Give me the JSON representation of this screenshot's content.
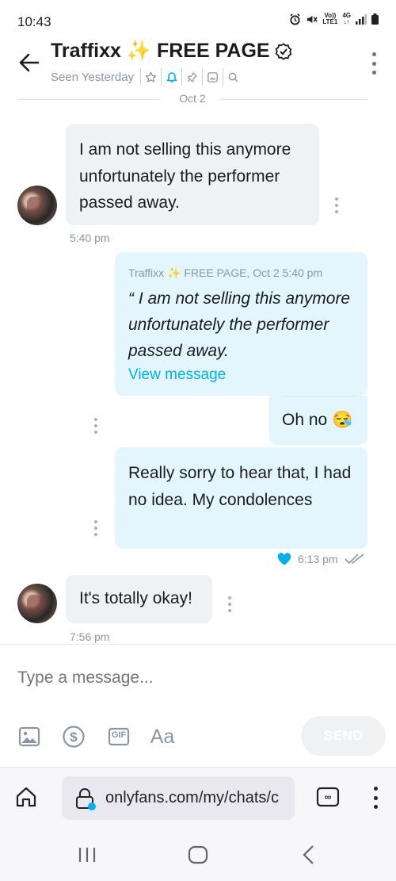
{
  "status_bar": {
    "time": "10:43",
    "network_top": "4G",
    "network_bottom": "LTE1",
    "volte": "Vo))"
  },
  "header": {
    "title": "Traffixx ✨ FREE PAGE",
    "seen": "Seen Yesterday",
    "icons": [
      "star-icon",
      "bell-icon",
      "pin-icon",
      "gallery-icon",
      "search-icon"
    ]
  },
  "messages": {
    "date_divider": "Oct 2",
    "m1": {
      "text": "I am not selling this anymore unfortunately the performer passed away.",
      "time": "5:40 pm"
    },
    "m2": {
      "quote_meta": "Traffixx ✨ FREE PAGE, Oct 2 5:40 pm",
      "quote_text": "“ I am not selling this anymore unfortunately the performer passed away.",
      "view_link": "View message"
    },
    "m3": {
      "text": "Oh no 😪"
    },
    "m4": {
      "text": "Really sorry to hear that, I had no idea. My condolences",
      "time": "6:13 pm"
    },
    "m5": {
      "text": "It's totally okay!",
      "time": "7:56 pm"
    }
  },
  "composer": {
    "placeholder": "Type a message...",
    "send_label": "SEND",
    "font_label": "Aa",
    "gif_label": "GIF"
  },
  "browser": {
    "url": "onlyfans.com/my/chats/c"
  },
  "colors": {
    "accent": "#00aff0",
    "incoming_bubble": "#f0f1f2",
    "outgoing_bubble": "#e3f6fd",
    "muted_text": "#8a96a3"
  }
}
